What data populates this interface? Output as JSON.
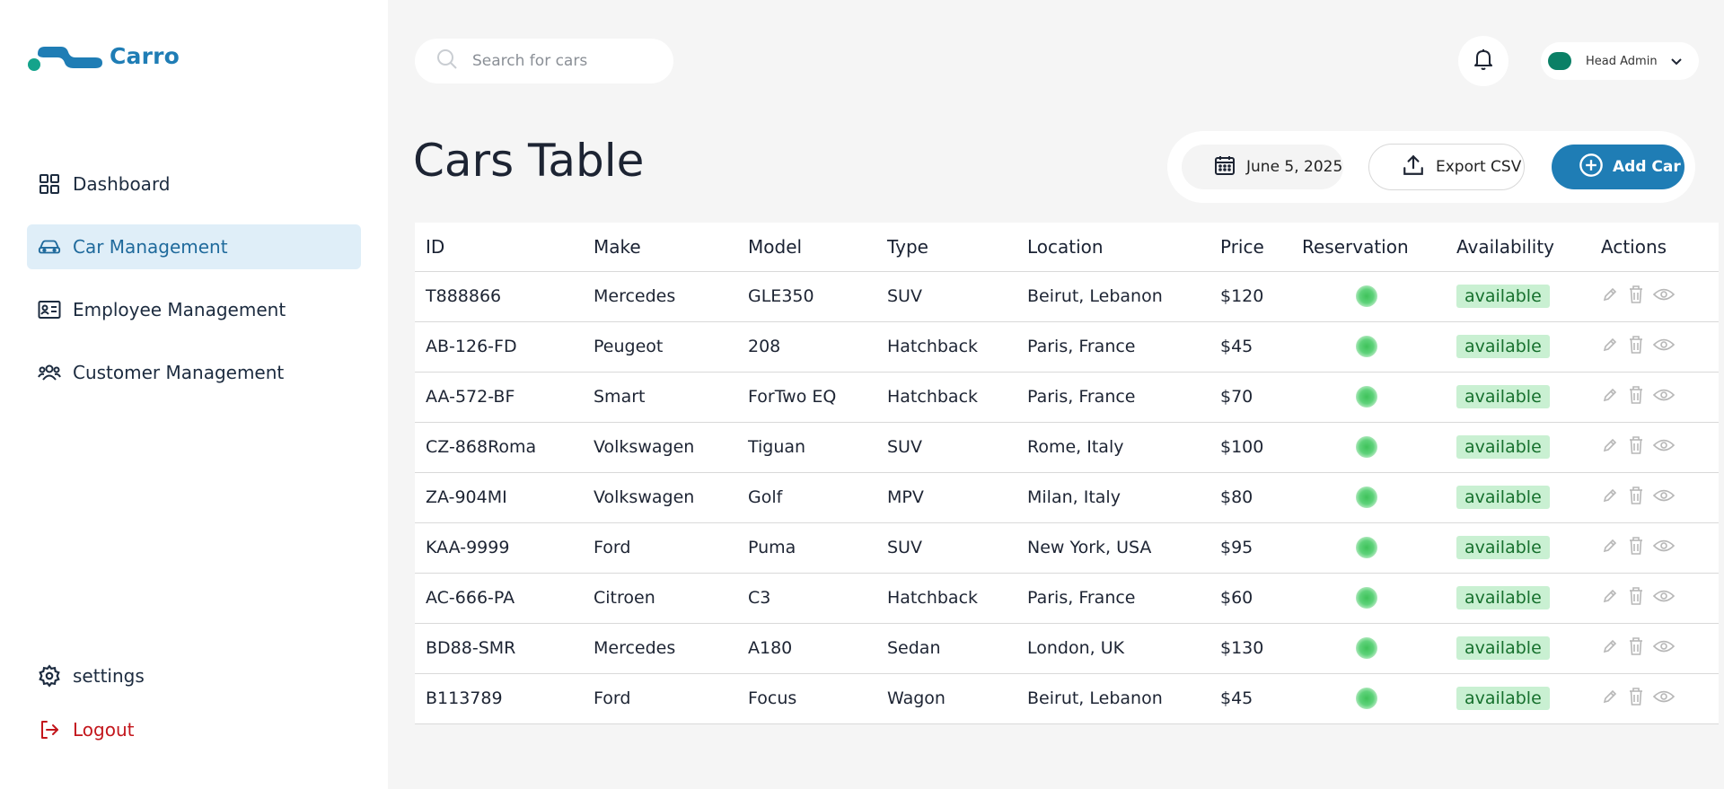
{
  "app": {
    "name": "Carro",
    "brand_color": "#1f7db5"
  },
  "sidebar": {
    "items": [
      {
        "label": "Dashboard",
        "icon": "grid-icon",
        "active": false
      },
      {
        "label": "Car Management",
        "icon": "car-icon",
        "active": true
      },
      {
        "label": "Employee Management",
        "icon": "id-card-icon",
        "active": false
      },
      {
        "label": "Customer Management",
        "icon": "users-icon",
        "active": false
      }
    ],
    "bottom": {
      "settings_label": "settings",
      "logout_label": "Logout"
    }
  },
  "header": {
    "search_placeholder": "Search for cars",
    "user_name": "Head Admin"
  },
  "main": {
    "title": "Cars Table",
    "date_label": "June 5, 2025",
    "export_label": "Export CSV",
    "add_label": "Add Car"
  },
  "table": {
    "columns": [
      "ID",
      "Make",
      "Model",
      "Type",
      "Location",
      "Price",
      "Reservation",
      "Availability",
      "Actions"
    ],
    "rows": [
      {
        "id": "T888866",
        "make": "Mercedes",
        "model": "GLE350",
        "type": "SUV",
        "location": "Beirut, Lebanon",
        "price": "$120",
        "availability": "available"
      },
      {
        "id": "AB-126-FD",
        "make": "Peugeot",
        "model": "208",
        "type": "Hatchback",
        "location": "Paris, France",
        "price": "$45",
        "availability": "available"
      },
      {
        "id": "AA-572-BF",
        "make": "Smart",
        "model": "ForTwo EQ",
        "type": "Hatchback",
        "location": "Paris, France",
        "price": "$70",
        "availability": "available"
      },
      {
        "id": "CZ-868Roma",
        "make": "Volkswagen",
        "model": "Tiguan",
        "type": "SUV",
        "location": "Rome, Italy",
        "price": "$100",
        "availability": "available"
      },
      {
        "id": "ZA-904MI",
        "make": "Volkswagen",
        "model": "Golf",
        "type": "MPV",
        "location": "Milan, Italy",
        "price": "$80",
        "availability": "available"
      },
      {
        "id": "KAA-9999",
        "make": "Ford",
        "model": "Puma",
        "type": "SUV",
        "location": "New York, USA",
        "price": "$95",
        "availability": "available"
      },
      {
        "id": "AC-666-PA",
        "make": "Citroen",
        "model": "C3",
        "type": "Hatchback",
        "location": "Paris, France",
        "price": "$60",
        "availability": "available"
      },
      {
        "id": "BD88-SMR",
        "make": "Mercedes",
        "model": "A180",
        "type": "Sedan",
        "location": "London, UK",
        "price": "$130",
        "availability": "available"
      },
      {
        "id": "B113789",
        "make": "Ford",
        "model": "Focus",
        "type": "Wagon",
        "location": "Beirut, Lebanon",
        "price": "$45",
        "availability": "available"
      }
    ]
  },
  "colors": {
    "available_bg": "#c9f0d2",
    "available_text": "#16702d",
    "reservation_dot": "#3fc25a",
    "logout": "#c3161c",
    "active_nav_bg": "#dfeef8"
  }
}
